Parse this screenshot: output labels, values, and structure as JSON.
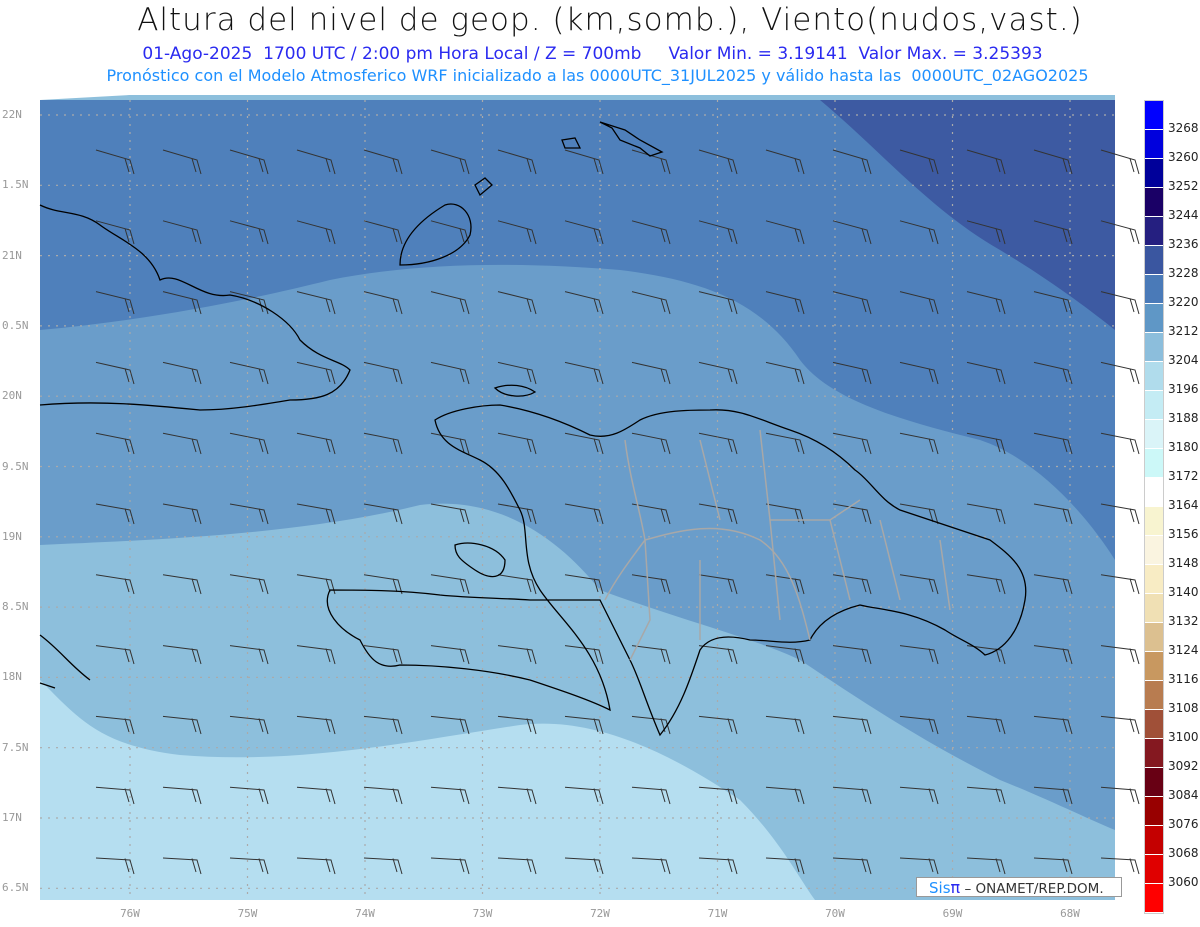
{
  "title": "Altura del nivel de geop. (km,somb.), Viento(nudos,vast.)",
  "subtitle": "01-Ago-2025  1700 UTC / 2:00 pm Hora Local / Z = 700mb     Valor Min. = 3.19141  Valor Max. = 3.25393",
  "forecast_note": "Pronóstico con el Modelo Atmosferico WRF inicializado a las 0000UTC_31JUL2025 y válido hasta las  0000UTC_02AGO2025",
  "credit": {
    "sis": "Sis",
    "pi": "π",
    "rest": "– ONAMET/REP.DOM."
  },
  "lat_labels": [
    "22N",
    "1.5N",
    "21N",
    "0.5N",
    "20N",
    "9.5N",
    "19N",
    "8.5N",
    "18N",
    "7.5N",
    "17N",
    "6.5N"
  ],
  "lon_labels": [
    "76W",
    "75W",
    "74W",
    "73W",
    "72W",
    "71W",
    "70W",
    "69W",
    "68W"
  ],
  "colorbar": {
    "labels": [
      "3268",
      "3260",
      "3252",
      "3244",
      "3236",
      "3228",
      "3220",
      "3212",
      "3204",
      "3196",
      "3188",
      "3180",
      "3172",
      "3164",
      "3156",
      "3148",
      "3140",
      "3132",
      "3124",
      "3116",
      "3108",
      "3100",
      "3092",
      "3084",
      "3076",
      "3068",
      "3060"
    ],
    "colors": [
      "#0000ff",
      "#0000dd",
      "#00009a",
      "#1a0066",
      "#251f80",
      "#3a56a0",
      "#4a7ab8",
      "#5f97c6",
      "#8cbedc",
      "#b0dcec",
      "#c4ecf4",
      "#daf4f8",
      "#ccf8f8",
      "#ffffff",
      "#f8f4d0",
      "#faf4e0",
      "#f8ecc4",
      "#f0e0b4",
      "#dcc090",
      "#c89860",
      "#b87c50",
      "#a05038",
      "#841820",
      "#680014",
      "#980000",
      "#c40000",
      "#e00000",
      "#ff0000"
    ]
  },
  "fill_colors": {
    "c3228": "#3d5aa2",
    "c3220": "#4f80bb",
    "c3212": "#6a9dca",
    "c3204": "#8dbfdc",
    "c3196": "#b5def0"
  }
}
